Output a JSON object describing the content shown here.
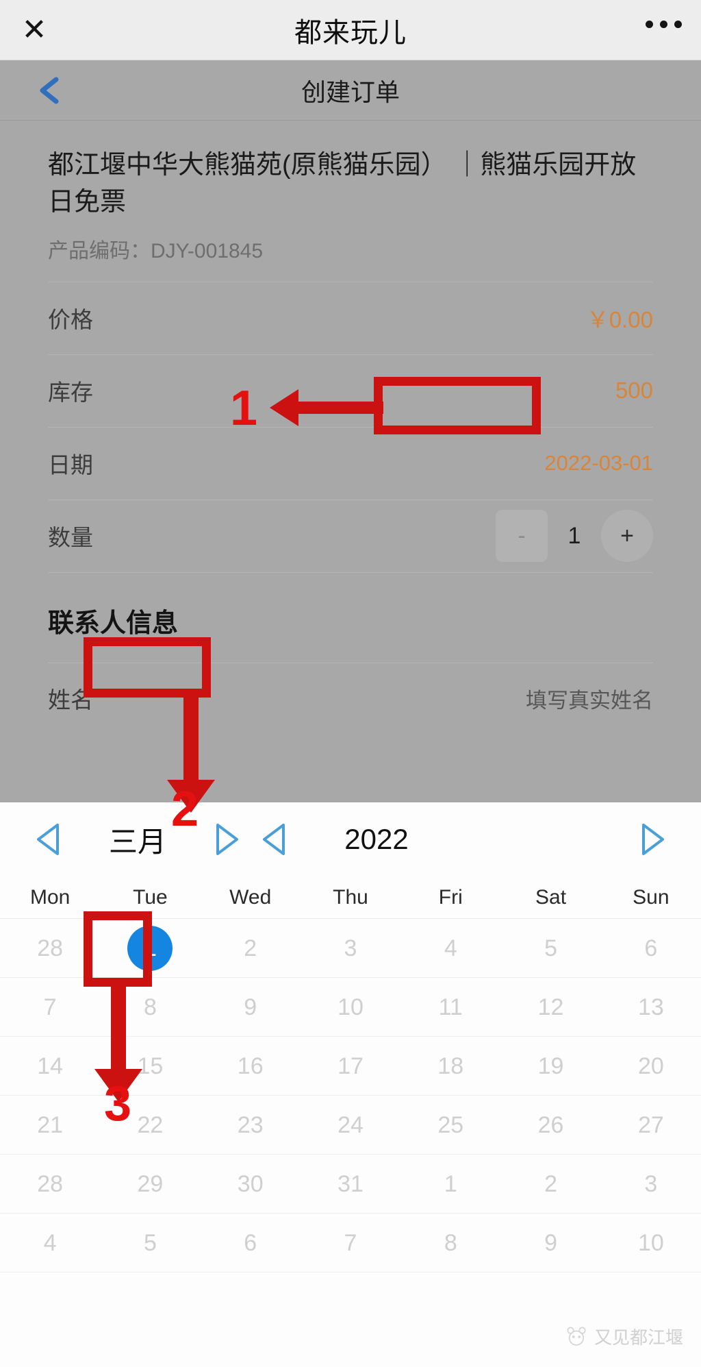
{
  "wechat_bar": {
    "close_icon": "close-icon",
    "title": "都来玩儿",
    "more_icon": "more-dots-icon"
  },
  "app_nav": {
    "back_icon": "chevron-left-icon",
    "title": "创建订单"
  },
  "product": {
    "title": "都江堰中华大熊猫苑(原熊猫乐园） ｜熊猫乐园开放日免票",
    "code_label": "产品编码：",
    "code_value": "DJY-001845"
  },
  "detail_rows": [
    {
      "label": "价格",
      "value": "￥0.00"
    },
    {
      "label": "库存",
      "value": "500"
    },
    {
      "label": "日期",
      "value": "2022-03-01"
    }
  ],
  "quantity_row": {
    "label": "数量",
    "minus_label": "-",
    "value": "1",
    "plus_label": "+"
  },
  "contact": {
    "section_title": "联系人信息",
    "name_label": "姓名",
    "name_placeholder": "填写真实姓名"
  },
  "calendar": {
    "prev_month_icon": "triangle-left-icon",
    "month": "三月",
    "next_month_icon": "triangle-right-icon",
    "prev_year_icon": "triangle-left-icon",
    "year": "2022",
    "next_year_icon": "triangle-right-icon",
    "weekdays": [
      "Mon",
      "Tue",
      "Wed",
      "Thu",
      "Fri",
      "Sat",
      "Sun"
    ],
    "weeks": [
      [
        "28",
        "1",
        "2",
        "3",
        "4",
        "5",
        "6"
      ],
      [
        "7",
        "8",
        "9",
        "10",
        "11",
        "12",
        "13"
      ],
      [
        "14",
        "15",
        "16",
        "17",
        "18",
        "19",
        "20"
      ],
      [
        "21",
        "22",
        "23",
        "24",
        "25",
        "26",
        "27"
      ],
      [
        "28",
        "29",
        "30",
        "31",
        "1",
        "2",
        "3"
      ],
      [
        "4",
        "5",
        "6",
        "7",
        "8",
        "9",
        "10"
      ]
    ],
    "selected": {
      "week": 0,
      "index": 1,
      "day": "1"
    }
  },
  "annotations": [
    {
      "number": "1",
      "target": "date-value"
    },
    {
      "number": "2",
      "target": "calendar-month"
    },
    {
      "number": "3",
      "target": "selected-day"
    }
  ],
  "watermark": {
    "text": "又见都江堰",
    "icon": "panda-icon"
  },
  "colors": {
    "accent_orange": "#d98539",
    "selected_blue": "#1486e1",
    "annotation_red": "#cc1111",
    "nav_blue": "#2f6fbd",
    "dim_overlay": "#a8a8a8"
  }
}
